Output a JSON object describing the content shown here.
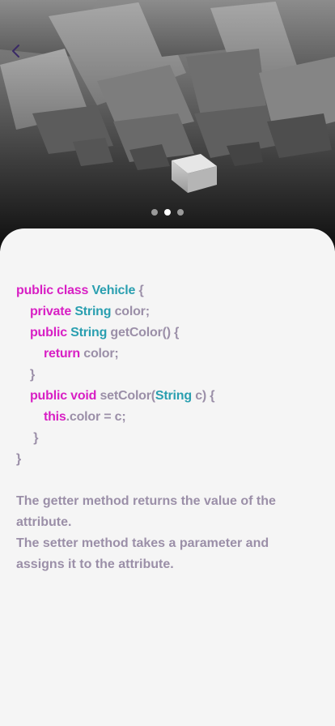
{
  "hero": {
    "slide_count": 3,
    "active_slide": 2
  },
  "code_lines": [
    [
      {
        "t": "public class ",
        "c": "kw"
      },
      {
        "t": "Vehicle",
        "c": "ty"
      },
      {
        "t": " {",
        "c": "tx"
      }
    ],
    [
      {
        "t": "    ",
        "c": "tx"
      },
      {
        "t": "private ",
        "c": "kw"
      },
      {
        "t": "String",
        "c": "ty"
      },
      {
        "t": " color;",
        "c": "tx"
      }
    ],
    [
      {
        "t": "    ",
        "c": "tx"
      },
      {
        "t": "public ",
        "c": "kw"
      },
      {
        "t": "String",
        "c": "ty"
      },
      {
        "t": " getColor() {",
        "c": "tx"
      }
    ],
    [
      {
        "t": "        ",
        "c": "tx"
      },
      {
        "t": "return",
        "c": "kw"
      },
      {
        "t": " color;",
        "c": "tx"
      }
    ],
    [
      {
        "t": "    }",
        "c": "tx"
      }
    ],
    [
      {
        "t": "    ",
        "c": "tx"
      },
      {
        "t": "public void ",
        "c": "kw"
      },
      {
        "t": "setColor(",
        "c": "tx"
      },
      {
        "t": "String",
        "c": "ty"
      },
      {
        "t": " c) {",
        "c": "tx"
      }
    ],
    [
      {
        "t": "        ",
        "c": "tx"
      },
      {
        "t": "this",
        "c": "kw"
      },
      {
        "t": ".color = c;",
        "c": "tx"
      }
    ],
    [
      {
        "t": "     }",
        "c": "tx"
      }
    ],
    [
      {
        "t": "}",
        "c": "tx"
      }
    ]
  ],
  "explanation": {
    "line1": "The getter method returns the value of the attribute.",
    "line2": "The setter method takes a parameter and assigns it to the attribute."
  },
  "colors": {
    "keyword": "#d81fc4",
    "type": "#2a9fb0",
    "text": "#9b8fa8",
    "back_icon": "#3a2a66"
  }
}
